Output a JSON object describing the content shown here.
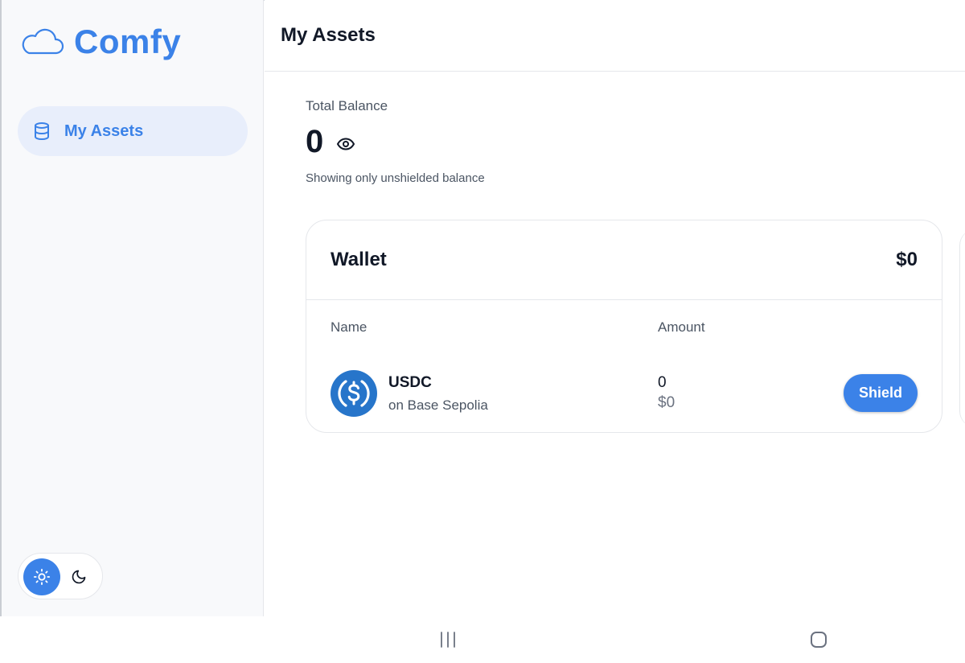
{
  "app": {
    "brand_name": "Comfy",
    "brand_color": "#3b82e8"
  },
  "sidebar": {
    "logo_icon": "cloud-icon",
    "items": [
      {
        "label": "My Assets",
        "icon": "database-icon",
        "active": true
      }
    ],
    "theme_toggle": {
      "options": [
        {
          "mode": "light",
          "icon": "sun-icon",
          "selected": true
        },
        {
          "mode": "dark",
          "icon": "moon-icon",
          "selected": false
        }
      ]
    }
  },
  "header": {
    "title": "My Assets"
  },
  "balance": {
    "label": "Total Balance",
    "value": "0",
    "toggle_icon": "eye-icon",
    "note": "Showing only unshielded balance"
  },
  "wallet_card": {
    "title": "Wallet",
    "total": "$0",
    "columns": [
      "Name",
      "Amount"
    ],
    "assets": [
      {
        "symbol": "USDC",
        "network": "on Base Sepolia",
        "icon": "usdc-icon",
        "icon_color": "#2775ca",
        "amount": "0",
        "usd_value": "$0",
        "action_label": "Shield"
      }
    ]
  },
  "system_nav": {
    "recents_icon": "recents-icon",
    "home_icon": "home-icon"
  }
}
